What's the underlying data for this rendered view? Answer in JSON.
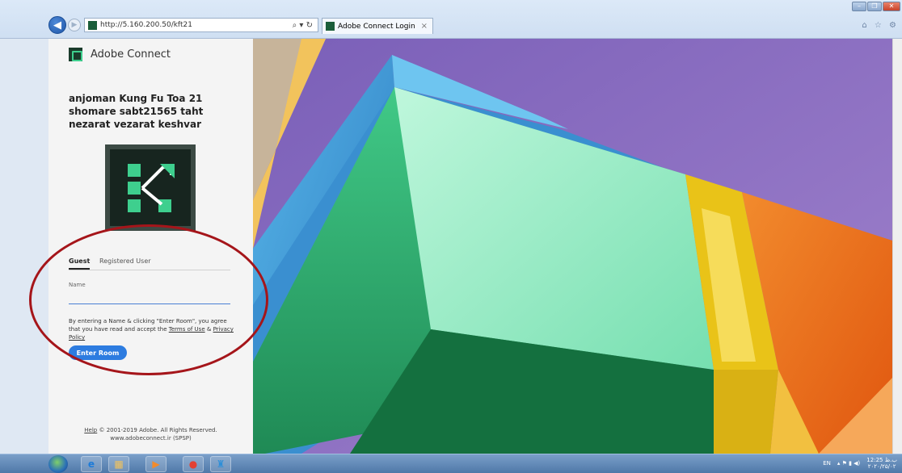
{
  "browser": {
    "url": "http://5.160.200.50/kft21",
    "address_tools": "⌕ ▾ ↻",
    "tab_title": "Adobe Connect Login",
    "tab_close": "×",
    "window_controls": {
      "minimize": "–",
      "maximize": "❐",
      "close": "✕"
    },
    "toolbar_icons": "⌂ ☆ ⚙"
  },
  "login": {
    "brand": "Adobe Connect",
    "room_title": "anjoman Kung Fu Toa 21 shomare sabt21565 taht nezarat vezarat keshvar",
    "tabs": {
      "guest": "Guest",
      "registered": "Registered User"
    },
    "name_label": "Name",
    "name_value": "",
    "consent_text": "By entering a Name & clicking \"Enter Room\", you agree that you have read and accept the",
    "terms_link": "Terms of Use",
    "and": "&",
    "privacy_link": "Privacy Policy",
    "enter_button": "Enter Room",
    "footer_help": "Help",
    "footer_copyright": "© 2001-2019 Adobe. All Rights Reserved.",
    "footer_site": "www.adobeconnect.ir (SPSP)"
  },
  "taskbar": {
    "tray_lang": "EN",
    "tray_icons": "▴ ⚑ ▮ ◀)",
    "time": "12:25 ب.ظ",
    "date": "۲۰۲۰/۲۵/۰۲"
  },
  "colors": {
    "accent": "#2d7ce0",
    "annotation": "#a5151a",
    "brand_green": "#3ecf8e"
  }
}
